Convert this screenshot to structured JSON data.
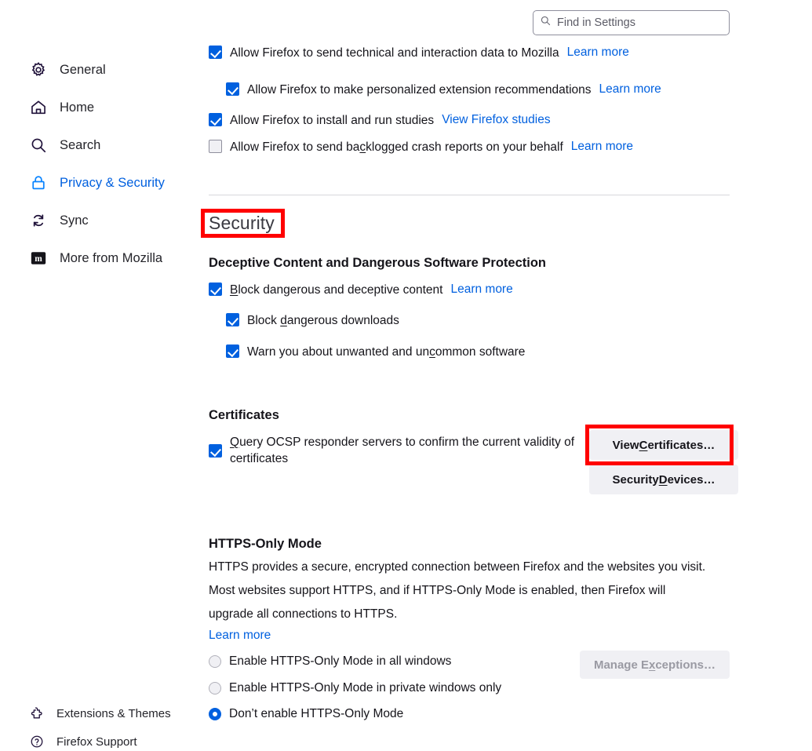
{
  "search": {
    "placeholder": "Find in Settings",
    "value": "",
    "icon": "search-icon"
  },
  "sidebar": {
    "items": [
      {
        "label": "General",
        "icon": "gear-icon",
        "selected": false
      },
      {
        "label": "Home",
        "icon": "home-icon",
        "selected": false
      },
      {
        "label": "Search",
        "icon": "search-icon",
        "selected": false
      },
      {
        "label": "Privacy & Security",
        "icon": "lock-icon",
        "selected": true
      },
      {
        "label": "Sync",
        "icon": "sync-icon",
        "selected": false
      },
      {
        "label": "More from Mozilla",
        "icon": "mozilla-m-icon",
        "selected": false
      }
    ],
    "footer_items": [
      {
        "label": "Extensions & Themes",
        "icon": "extensions-icon"
      },
      {
        "label": "Firefox Support",
        "icon": "help-circle-icon"
      }
    ]
  },
  "data_collection": {
    "row_technical": {
      "label": "Allow Firefox to send technical and interaction data to Mozilla",
      "link": "Learn more",
      "checked": true
    },
    "row_recommendations": {
      "label": "Allow Firefox to make personalized extension recommendations",
      "link": "Learn more",
      "checked": true
    },
    "row_studies": {
      "label": "Allow Firefox to install and run studies",
      "link": "View Firefox studies",
      "checked": true
    },
    "row_crash": {
      "label_before": "Allow Firefox to send ba",
      "label_key": "c",
      "label_after": "klogged crash reports on your behalf",
      "link": "Learn more",
      "checked": false
    }
  },
  "security": {
    "heading": "Security",
    "deceptive": {
      "heading": "Deceptive Content and Dangerous Software Protection",
      "block_content": {
        "key": "B",
        "rest": "lock dangerous and deceptive content",
        "link": "Learn more",
        "checked": true
      },
      "block_downloads": {
        "before": "Block ",
        "key": "d",
        "after": "angerous downloads",
        "checked": true
      },
      "warn_uncommon": {
        "before": "Warn you about unwanted and un",
        "key": "c",
        "after": "ommon software",
        "checked": true
      }
    },
    "certificates": {
      "heading": "Certificates",
      "ocsp": {
        "key": "Q",
        "rest": "uery OCSP responder servers to confirm the current validity of certificates",
        "checked": true
      },
      "view_certificates_button": {
        "before": "View ",
        "key": "C",
        "after": "ertificates…"
      },
      "security_devices_button": {
        "before": "Security ",
        "key": "D",
        "after": "evices…"
      }
    },
    "https_only": {
      "heading": "HTTPS-Only Mode",
      "description": "HTTPS provides a secure, encrypted connection between Firefox and the websites you visit. Most websites support HTTPS, and if HTTPS-Only Mode is enabled, then Firefox will upgrade all connections to HTTPS.",
      "description_lines": [
        "HTTPS provides a secure, encrypted connection between Firefox and the websites you visit.",
        "Most websites support HTTPS, and if HTTPS-Only Mode is enabled, then Firefox will",
        "upgrade all connections to HTTPS."
      ],
      "link": "Learn more",
      "options": [
        {
          "label": "Enable HTTPS-Only Mode in all windows",
          "selected": false
        },
        {
          "label": "Enable HTTPS-Only Mode in private windows only",
          "selected": false
        },
        {
          "label": "Don’t enable HTTPS-Only Mode",
          "selected": true
        }
      ],
      "manage_exceptions_button": {
        "before": "Manage E",
        "key": "x",
        "after": "ceptions…",
        "disabled": true
      }
    }
  },
  "highlights": [
    {
      "name": "security-heading-highlight",
      "color": "#ff0000"
    },
    {
      "name": "view-certificates-highlight",
      "color": "#ff0000"
    }
  ]
}
